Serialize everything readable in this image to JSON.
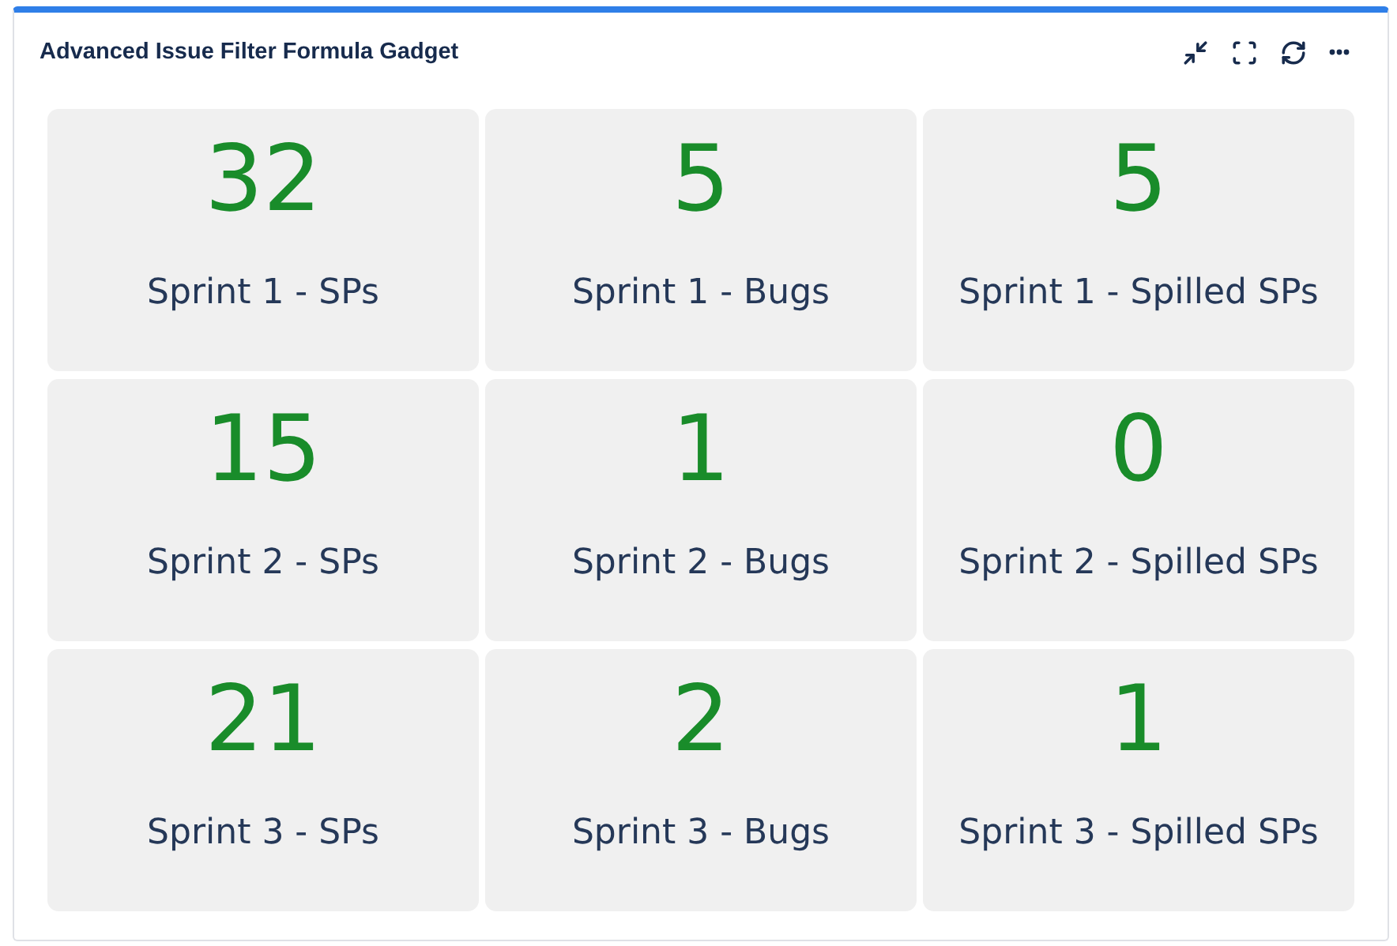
{
  "gadget": {
    "title": "Advanced Issue Filter Formula Gadget"
  },
  "tiles": [
    {
      "value": "32",
      "label": "Sprint 1 - SPs"
    },
    {
      "value": "5",
      "label": "Sprint 1 - Bugs"
    },
    {
      "value": "5",
      "label": "Sprint 1 - Spilled SPs"
    },
    {
      "value": "15",
      "label": "Sprint 2 - SPs"
    },
    {
      "value": "1",
      "label": "Sprint 2 - Bugs"
    },
    {
      "value": "0",
      "label": "Sprint 2 - Spilled SPs"
    },
    {
      "value": "21",
      "label": "Sprint 3 - SPs"
    },
    {
      "value": "2",
      "label": "Sprint 3 - Bugs"
    },
    {
      "value": "1",
      "label": "Sprint 3 - Spilled SPs"
    }
  ]
}
